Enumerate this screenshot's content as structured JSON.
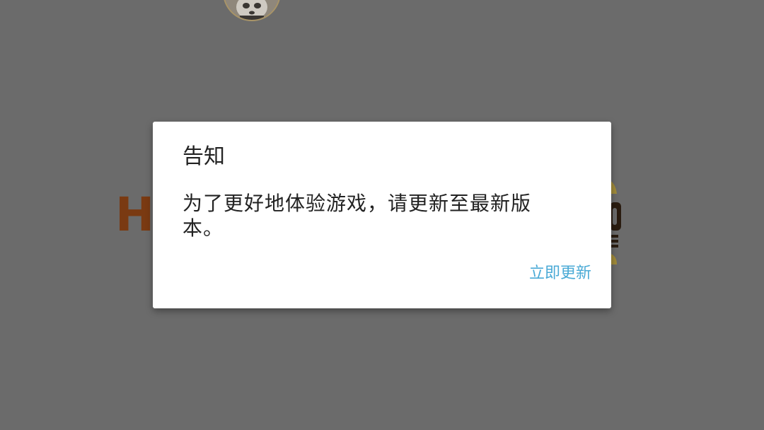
{
  "background": {
    "overlay_color": "#6b6b6b",
    "partial_letter": "H",
    "avatar_icon": "panda-avatar-icon",
    "right_decoration_icon": "game-logo-fragment-icon"
  },
  "dialog": {
    "title": "告知",
    "message": "为了更好地体验游戏，请更新至最新版本。",
    "update_button_label": "立即更新",
    "button_color": "#4aaad6"
  }
}
